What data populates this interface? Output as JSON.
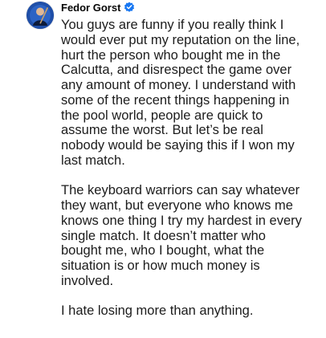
{
  "author": {
    "name": "Fedor Gorst",
    "verified": true,
    "verified_color": "#1877f2",
    "avatar_icon": "profile-photo"
  },
  "post": {
    "paragraphs": [
      {
        "lines": [
          "You guys are funny if you really think I",
          "would ever put my reputation on the line,",
          "hurt the person who bought me in the",
          "Calcutta, and disrespect the game over",
          "any amount of money. I understand with",
          "some of the recent things happening in",
          "the pool world, people are quick to",
          "assume the worst. But let’s be real",
          "nobody would be saying this if I won my",
          "last match."
        ]
      },
      {
        "lines": [
          "The keyboard warriors can say whatever",
          "they want, but everyone who knows me",
          "knows one thing I try my hardest in every",
          "single match. It doesn’t matter who",
          "bought me, who I bought, what the",
          "situation is or how much money is",
          "involved."
        ]
      },
      {
        "lines": [
          "I hate losing more than anything."
        ]
      }
    ]
  }
}
